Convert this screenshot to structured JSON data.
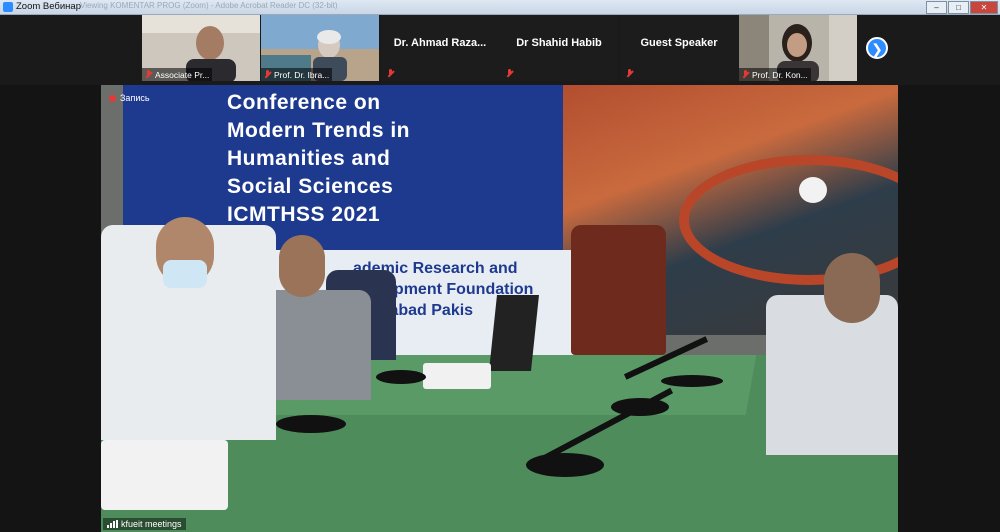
{
  "window": {
    "title": "Zoom Вебинар",
    "ghost_title": "Viewing KOMENTAR PROG (Zoom) - Adobe Acrobat Reader DC (32-bit)"
  },
  "participants": [
    {
      "name": "Associate Pr...",
      "video": true
    },
    {
      "name": "Prof. Dr. Ibra...",
      "video": true
    },
    {
      "name": "Dr. Ahmad Raza...",
      "video": false
    },
    {
      "name": "Dr Shahid Habib",
      "video": false
    },
    {
      "name": "Guest Speaker",
      "video": false
    },
    {
      "name": "Prof. Dr. Kon...",
      "video": true
    }
  ],
  "recording_label": "Запись",
  "meeting_label": "kfueit meetings",
  "banner": {
    "line1": "Conference on",
    "line2": "Modern Trends in",
    "line3": "Humanities and",
    "line4": "Social Sciences",
    "line5": "ICMTHSS 2021",
    "lower1": "ademic Research and",
    "lower2": "evelopment Foundation",
    "lower3": "slamabad Pakis"
  },
  "colors": {
    "zoom_blue": "#2d8cff",
    "muted_red": "#e53935",
    "banner_blue": "#1e3a8f",
    "table_green": "#4e8c5c"
  }
}
